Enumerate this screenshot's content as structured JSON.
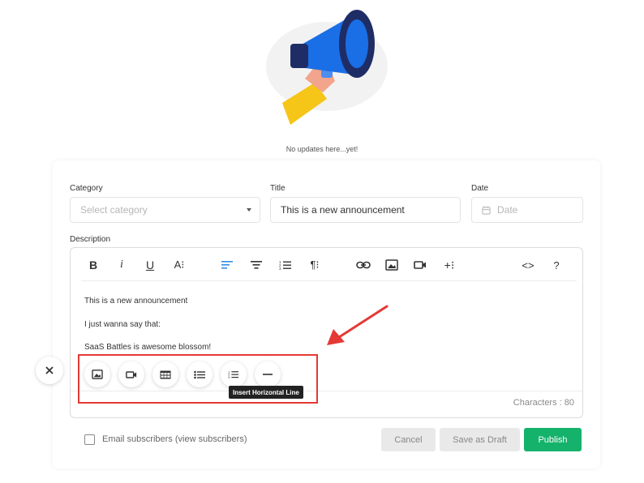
{
  "empty_state": {
    "message": "No updates here...yet!"
  },
  "form": {
    "category": {
      "label": "Category",
      "placeholder": "Select category"
    },
    "title": {
      "label": "Title",
      "value": "This is a new announcement"
    },
    "date": {
      "label": "Date",
      "placeholder": "Date"
    },
    "description": {
      "label": "Description"
    }
  },
  "toolbar": {
    "bold": "B",
    "italic": "i",
    "underline": "U",
    "font_size": "A⁝",
    "paragraph": "¶⁝",
    "more": "+⁝",
    "code": "<>",
    "help": "?"
  },
  "editor": {
    "lines": [
      "This is a new announcement",
      "I just wanna say that:",
      "SaaS Battles is awesome blossom!"
    ],
    "characters_label": "Characters : 80"
  },
  "quick_insert": {
    "tooltip": "Insert Horizontal Line"
  },
  "footer": {
    "email_label": "Email subscribers (view subscribers)",
    "cancel": "Cancel",
    "save_draft": "Save as Draft",
    "publish": "Publish"
  },
  "colors": {
    "accent": "#2f8fe6",
    "publish": "#14b26b",
    "annotation": "#e53935"
  }
}
